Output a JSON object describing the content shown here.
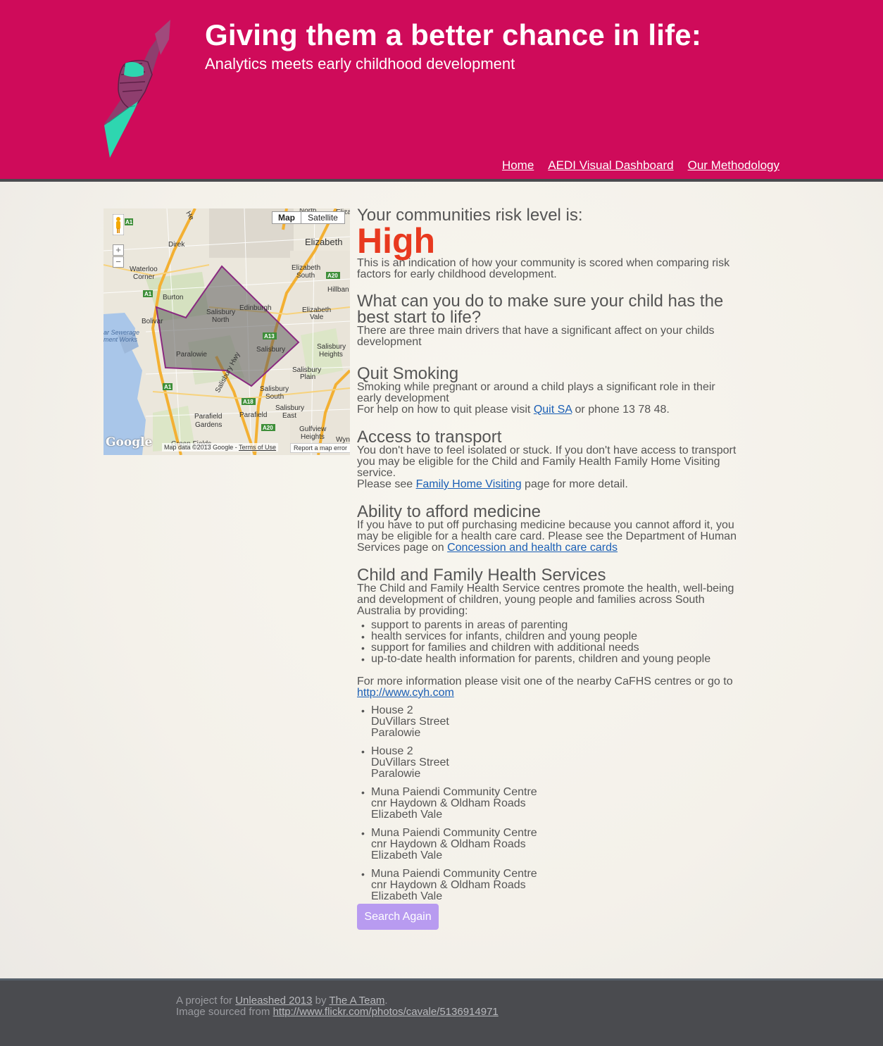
{
  "header": {
    "title": "Giving them a better chance in life:",
    "subtitle": "Analytics meets early childhood development",
    "nav": [
      "Home",
      "AEDI Visual Dashboard",
      "Our Methodology"
    ]
  },
  "map": {
    "type_buttons": {
      "map": "Map",
      "satellite": "Satellite"
    },
    "zoom_in": "+",
    "zoom_out": "−",
    "logo": "Google",
    "attribution": "Map data ©2013 Google -",
    "terms": "Terms of Use",
    "report": "Report a map error",
    "labels": {
      "direk": "Direk",
      "waterloo": "Waterloo",
      "corner": "Corner",
      "burton": "Burton",
      "bolivar": "Bolivar",
      "elizabeth": "Elizabeth",
      "elizabeth_south_1": "Elizabeth",
      "elizabeth_south_2": "South",
      "hillbank": "Hillban",
      "elizabeth_vale_1": "Elizabeth",
      "elizabeth_vale_2": "Vale",
      "edinburgh": "Edinburgh",
      "salisbury_north_1": "Salisbury",
      "salisbury_north_2": "North",
      "salisbury": "Salisbury",
      "paralowie": "Paralowie",
      "salisbury_heights_1": "Salisbury",
      "salisbury_heights_2": "Heights",
      "salisbury_plain_1": "Salisbury",
      "salisbury_plain_2": "Plain",
      "salisbury_south_1": "Salisbury",
      "salisbury_south_2": "South",
      "salisbury_east_1": "Salisbury",
      "salisbury_east_2": "East",
      "parafield_gardens_1": "Parafield",
      "parafield_gardens_2": "Gardens",
      "parafield": "Parafield",
      "gulfview_1": "Gulfview",
      "gulfview_2": "Heights",
      "green_fields": "Green Fields",
      "sewerage_1": "ar Sewerage",
      "sewerage_2": "ment Works",
      "north": "North",
      "salisbury_hwy": "Salisbury Hwy",
      "he": "He",
      "wyn": "Wyn",
      "elizab": "Elizal",
      "a1": "A1",
      "a13": "A13",
      "a18": "A18",
      "a20": "A20"
    },
    "colors": {
      "boundary": "#8a2a80",
      "fill": "#5c5c5c",
      "road": "#f3b033"
    }
  },
  "content": {
    "risk_heading": "Your communities risk level is:",
    "risk_level": "High",
    "risk_colour": "#e8391f",
    "risk_desc": "This is an indication of how your community is scored when comparing risk factors for early childhood development.",
    "what_heading": "What can you do to make sure your child has the best start to life?",
    "what_desc": "There are three main drivers that have a significant affect on your childs development",
    "smoking": {
      "heading": "Quit Smoking",
      "text": "Smoking while pregnant or around a child plays a significant role in their early development",
      "help_prefix": "For help on how to quit please visit",
      "link": "Quit SA",
      "help_suffix": "or phone 13 78 48."
    },
    "transport": {
      "heading": "Access to transport",
      "text": "You don't have to feel isolated or stuck. If you don't have access to transport you may be eligible for the Child and Family Health Family Home Visiting service.",
      "see_prefix": "Please see",
      "link": "Family Home Visiting",
      "see_suffix": "page for more detail."
    },
    "medicine": {
      "heading": "Ability to afford medicine",
      "text": "If you have to put off purchasing medicine because you cannot afford it, you may be eligible for a health care card. Please see the Department of Human Services page on",
      "link": "Concession and health care cards"
    },
    "cafhs": {
      "heading": "Child and Family Health Services",
      "text": "The Child and Family Health Service centres promote the health, well-being and development of children, young people and families across South Australia by providing:",
      "items": [
        "support to parents in areas of parenting",
        "health services for infants, children and young people",
        "support for families and children with additional needs",
        "up-to-date health information for parents, children and young people"
      ],
      "more_prefix": "For more information please visit one of the nearby CaFHS centres or go to",
      "more_link": "http://www.cyh.com"
    },
    "centres": [
      [
        "House 2",
        "DuVillars Street",
        "Paralowie"
      ],
      [
        "House 2",
        "DuVillars Street",
        "Paralowie"
      ],
      [
        "Muna Paiendi Community Centre",
        "cnr Haydown & Oldham Roads",
        "Elizabeth Vale"
      ],
      [
        "Muna Paiendi Community Centre",
        "cnr Haydown & Oldham Roads",
        "Elizabeth Vale"
      ],
      [
        "Muna Paiendi Community Centre",
        "cnr Haydown & Oldham Roads",
        "Elizabeth Vale"
      ]
    ],
    "search_again": "Search Again"
  },
  "footer": {
    "prefix": "A project for",
    "event_link": "Unleashed 2013",
    "by": "by",
    "team_link": "The A Team",
    "period": ".",
    "image_prefix": "Image sourced from",
    "image_link": "http://www.flickr.com/photos/cavale/5136914971"
  }
}
